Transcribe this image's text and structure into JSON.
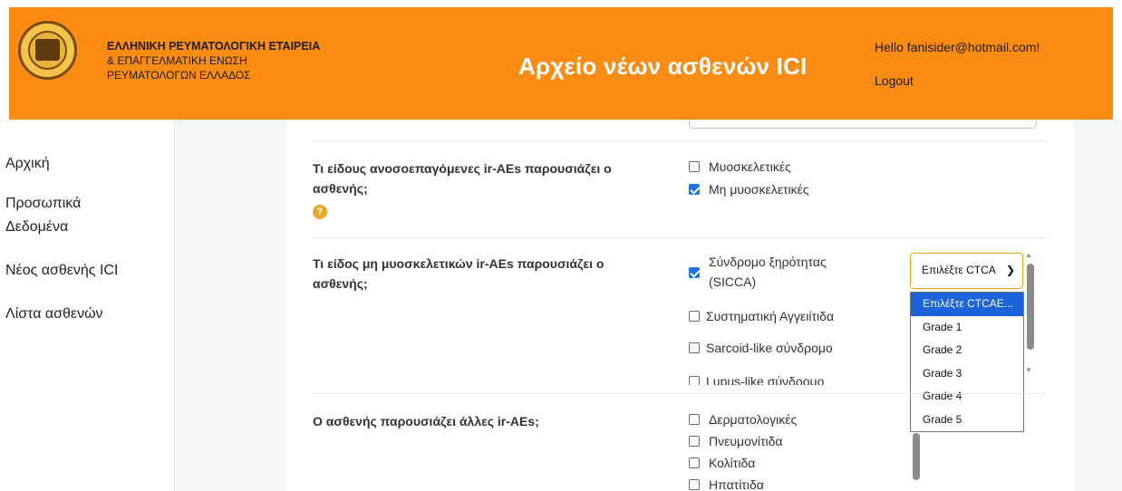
{
  "header": {
    "org_line1": "ΕΛΛΗΝΙΚΗ ΡΕΥΜΑΤΟΛΟΓΙΚΗ ΕΤΑΙΡΕΙΑ",
    "org_line2": "& ΕΠΑΓΓΕΛΜΑΤΙΚΗ ΕΝΩΣΗ",
    "org_line3": "ΡΕΥΜΑΤΟΛΟΓΩΝ ΕΛΛΑΔΟΣ",
    "site_title": "Αρχείο νέων ασθενών ICI",
    "hello": "Hello fanisider@hotmail.com!",
    "logout": "Logout",
    "brand_color": "#fb8c13"
  },
  "sidebar": {
    "items": [
      {
        "label": "Αρχική"
      },
      {
        "label": "Προσωπικά"
      },
      {
        "label": "Δεδομένα"
      },
      {
        "label": "Νέος ασθενής ICI"
      },
      {
        "label": "Λίστα ασθενών"
      }
    ]
  },
  "form": {
    "q1": {
      "label_l1": "Τι είδους ανοσοεπαγόμενες ir-AEs παρουσιάζει ο",
      "label_l2": "ασθενής;",
      "options": [
        {
          "label": "Μυοσκελετικές",
          "checked": false
        },
        {
          "label": "Μη μυοσκελετικές",
          "checked": true
        }
      ]
    },
    "q2": {
      "label_l1": "Τι είδος μη μυοσκελετικών ir-AEs παρουσιάζει ο",
      "label_l2": "ασθενής;",
      "options": [
        {
          "label_l1": "Σύνδρομο ξηρότητας",
          "label_l2": "(SICCA)",
          "checked": true
        },
        {
          "label": "Συστηματική Αγγειίτιδα",
          "checked": false
        },
        {
          "label": "Sarcoid-like σύνδρομο",
          "checked": false
        },
        {
          "label": "Lupus-like σύνδρομο",
          "checked": false
        }
      ],
      "select_value": "Επιλέξτε CTCA",
      "dropdown_options": [
        "Επιλέξτε CTCAE...",
        "Grade 1",
        "Grade 2",
        "Grade 3",
        "Grade 4",
        "Grade 5"
      ],
      "dropdown_selected_index": 0
    },
    "q3": {
      "label": "Ο ασθενής παρουσιάζει άλλες ir-AEs;",
      "options": [
        {
          "label": "Δερματολογικές",
          "checked": false
        },
        {
          "label": "Πνευμονίτιδα",
          "checked": false
        },
        {
          "label": "Κολίτιδα",
          "checked": false
        },
        {
          "label": "Ηπατίτιδα",
          "checked": false
        }
      ]
    }
  }
}
